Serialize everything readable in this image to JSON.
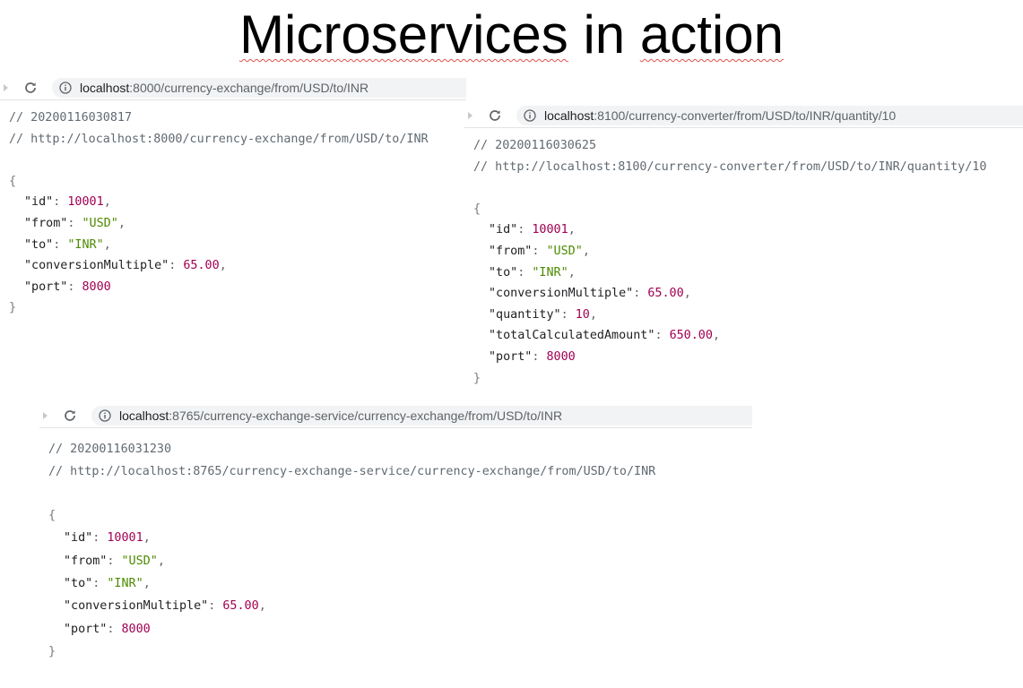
{
  "title": {
    "word1": "Microservices",
    "word2": "in",
    "word3": "action"
  },
  "panels": [
    {
      "url_host": "localhost",
      "url_path": ":8000/currency-exchange/from/USD/to/INR",
      "timestamp_comment": "// 20200116030817",
      "url_comment": "// http://localhost:8000/currency-exchange/from/USD/to/INR",
      "open_brace": "{",
      "close_brace": "}",
      "fields": [
        {
          "key": "\"id\"",
          "value": "10001",
          "type": "num",
          "sep": ","
        },
        {
          "key": "\"from\"",
          "value": "\"USD\"",
          "type": "str",
          "sep": ","
        },
        {
          "key": "\"to\"",
          "value": "\"INR\"",
          "type": "str",
          "sep": ","
        },
        {
          "key": "\"conversionMultiple\"",
          "value": "65.00",
          "type": "num",
          "sep": ","
        },
        {
          "key": "\"port\"",
          "value": "8000",
          "type": "num",
          "sep": ""
        }
      ]
    },
    {
      "url_host": "localhost",
      "url_path": ":8100/currency-converter/from/USD/to/INR/quantity/10",
      "timestamp_comment": "// 20200116030625",
      "url_comment": "// http://localhost:8100/currency-converter/from/USD/to/INR/quantity/10",
      "open_brace": "{",
      "close_brace": "}",
      "fields": [
        {
          "key": "\"id\"",
          "value": "10001",
          "type": "num",
          "sep": ","
        },
        {
          "key": "\"from\"",
          "value": "\"USD\"",
          "type": "str",
          "sep": ","
        },
        {
          "key": "\"to\"",
          "value": "\"INR\"",
          "type": "str",
          "sep": ","
        },
        {
          "key": "\"conversionMultiple\"",
          "value": "65.00",
          "type": "num",
          "sep": ","
        },
        {
          "key": "\"quantity\"",
          "value": "10",
          "type": "num",
          "sep": ","
        },
        {
          "key": "\"totalCalculatedAmount\"",
          "value": "650.00",
          "type": "num",
          "sep": ","
        },
        {
          "key": "\"port\"",
          "value": "8000",
          "type": "num",
          "sep": ""
        }
      ]
    },
    {
      "url_host": "localhost",
      "url_path": ":8765/currency-exchange-service/currency-exchange/from/USD/to/INR",
      "timestamp_comment": "// 20200116031230",
      "url_comment": "// http://localhost:8765/currency-exchange-service/currency-exchange/from/USD/to/INR",
      "open_brace": "{",
      "close_brace": "}",
      "fields": [
        {
          "key": "\"id\"",
          "value": "10001",
          "type": "num",
          "sep": ","
        },
        {
          "key": "\"from\"",
          "value": "\"USD\"",
          "type": "str",
          "sep": ","
        },
        {
          "key": "\"to\"",
          "value": "\"INR\"",
          "type": "str",
          "sep": ","
        },
        {
          "key": "\"conversionMultiple\"",
          "value": "65.00",
          "type": "num",
          "sep": ","
        },
        {
          "key": "\"port\"",
          "value": "8000",
          "type": "num",
          "sep": ""
        }
      ]
    }
  ],
  "colors": {
    "number": "#a00052",
    "string": "#4d8a00",
    "comment": "#616a72",
    "url_bar": "#f1f3f4"
  },
  "icons": [
    "expand-triangle-icon",
    "reload-icon",
    "info-icon"
  ]
}
